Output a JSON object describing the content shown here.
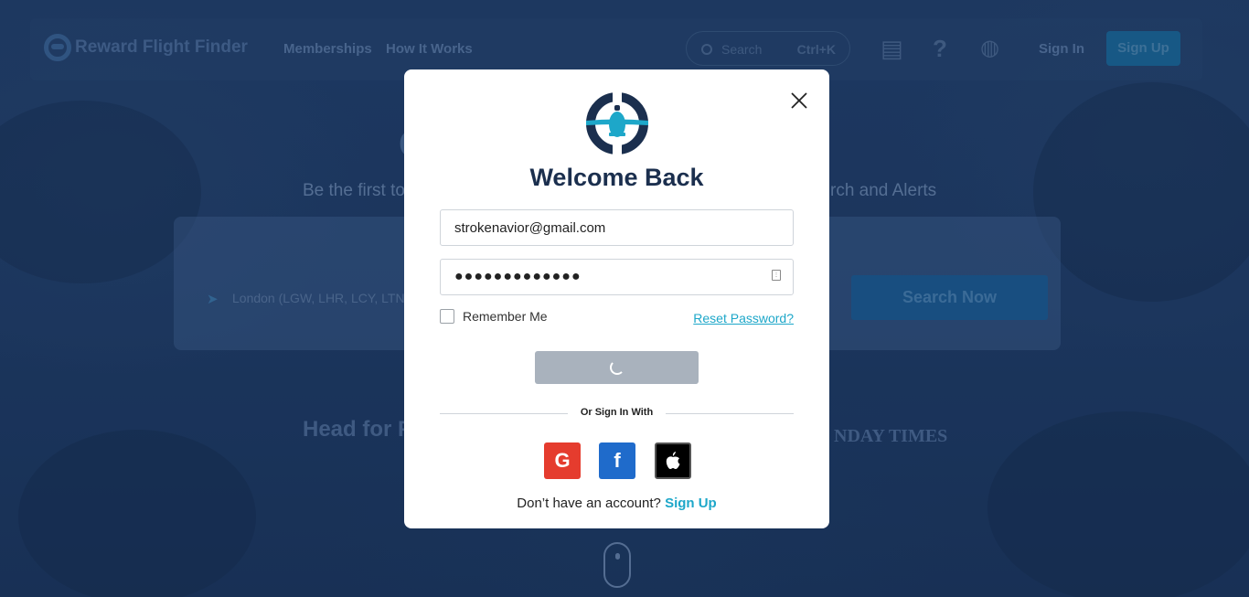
{
  "background": {
    "logo_text": "Reward Flight Finder",
    "nav": [
      "Memberships",
      "How It Works"
    ],
    "search_placeholder": "Search",
    "search_shortcut": "Ctrl+K",
    "sign_in": "Sign In",
    "sign_up": "Sign Up",
    "subtitle_left": "Be the first to",
    "subtitle_right": "rch and Alerts",
    "origin_field": "London (LGW, LHR, LCY, LTN,",
    "search_now": "Search Now",
    "press_left": "Head for P",
    "press_right": "NDAY TIMES"
  },
  "modal": {
    "title": "Welcome Back",
    "email_value": "strokenavior@gmail.com",
    "password_value": "●●●●●●●●●●●●●",
    "remember_label": "Remember Me",
    "reset_link": "Reset Password?",
    "divider_text": "Or Sign In With",
    "signup_prompt": "Don’t have an account?",
    "signup_link": "Sign Up"
  },
  "icons": [
    "close-icon",
    "plane-logo-icon",
    "google-icon",
    "facebook-icon",
    "apple-icon",
    "password-reveal-icon",
    "spinner-icon"
  ],
  "colors": {
    "accent": "#1da7c9",
    "title": "#1b2f4e",
    "google": "#e53c2e",
    "facebook": "#1f6bcb",
    "apple": "#000000",
    "button_disabled": "#a9b2bd"
  }
}
